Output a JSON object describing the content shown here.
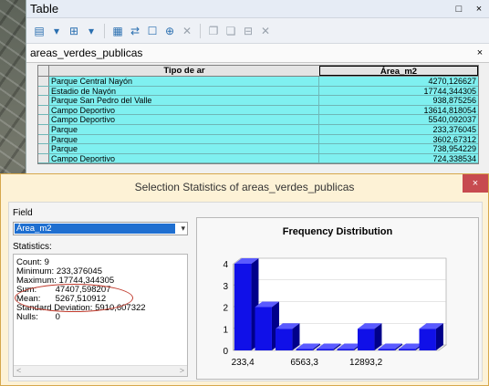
{
  "table_window": {
    "title": "Table",
    "restore_label": "□",
    "close_label": "×",
    "toolbar": [
      {
        "name": "table-options-icon",
        "glyph": "▤",
        "gray": false
      },
      {
        "name": "dropdown-icon",
        "glyph": "▾",
        "gray": false
      },
      {
        "name": "related-tables-icon",
        "glyph": "⊞",
        "gray": false
      },
      {
        "name": "dropdown-icon-2",
        "glyph": "▾",
        "gray": false
      },
      {
        "name": "select-by-attributes-icon",
        "glyph": "▦",
        "gray": false
      },
      {
        "name": "switch-selection-icon",
        "glyph": "⇄",
        "gray": false
      },
      {
        "name": "clear-selection-icon",
        "glyph": "☐",
        "gray": false
      },
      {
        "name": "zoom-selected-icon",
        "glyph": "⊕",
        "gray": false
      },
      {
        "name": "delete-selected-icon",
        "glyph": "✕",
        "gray": true
      },
      {
        "name": "copy-icon",
        "glyph": "❐",
        "gray": true
      },
      {
        "name": "paste-icon",
        "glyph": "❏",
        "gray": true
      },
      {
        "name": "add-field-icon",
        "glyph": "⊟",
        "gray": true
      },
      {
        "name": "delete-field-icon",
        "glyph": "✕",
        "gray": true
      }
    ],
    "tab_name": "areas_verdes_publicas",
    "tab_close": "×",
    "columns": [
      "Tipo de ar",
      "Área_m2"
    ],
    "rows": [
      [
        "Parque Central Nayón",
        "4270,126627"
      ],
      [
        "Estadio de Nayón",
        "17744,344305"
      ],
      [
        "Parque San Pedro del Valle",
        "938,875256"
      ],
      [
        "Campo Deportivo",
        "13614,818054"
      ],
      [
        "Campo Deportivo",
        "5540,092037"
      ],
      [
        "Parque",
        "233,376045"
      ],
      [
        "Parque",
        "3602,67312"
      ],
      [
        "Parque",
        "738,954229"
      ],
      [
        "Campo Deportivo",
        "724,338534"
      ]
    ]
  },
  "dialog": {
    "title": "Selection Statistics of areas_verdes_publicas",
    "close_label": "×",
    "field_label": "Field",
    "field_value": "Área_m2",
    "statistics_label": "Statistics:",
    "stats": [
      {
        "key": "Count:",
        "value": "9"
      },
      {
        "key": "Minimum:",
        "value": "233,376045"
      },
      {
        "key": "Maximum:",
        "value": "17744,344305"
      },
      {
        "key": "Sum:",
        "value": "47407,598207"
      },
      {
        "key": "Mean:",
        "value": "5267,510912"
      },
      {
        "key": "Standard Deviation:",
        "value": "5910,607322"
      },
      {
        "key": "Nulls:",
        "value": "0"
      }
    ],
    "scroll_left": "<",
    "scroll_right": ">"
  },
  "colors": {
    "bar_front": "#1010e8",
    "bar_top": "#5a5aff",
    "bar_side": "#00008a",
    "highlight": "#c0392b"
  },
  "chart_data": {
    "type": "bar",
    "title": "Frequency Distribution",
    "categories": [
      "bin1",
      "bin2",
      "bin3",
      "bin4",
      "bin5",
      "bin6",
      "bin7",
      "bin8",
      "bin9",
      "bin10"
    ],
    "values": [
      4,
      2,
      1,
      0,
      0,
      0,
      1,
      0,
      0,
      1
    ],
    "x_tick_labels": [
      "233,4",
      "6563,3",
      "12893,2"
    ],
    "y_ticks": [
      0,
      1,
      2,
      3,
      4
    ],
    "ylim": [
      0,
      4
    ],
    "grid": true,
    "style": "3d"
  }
}
